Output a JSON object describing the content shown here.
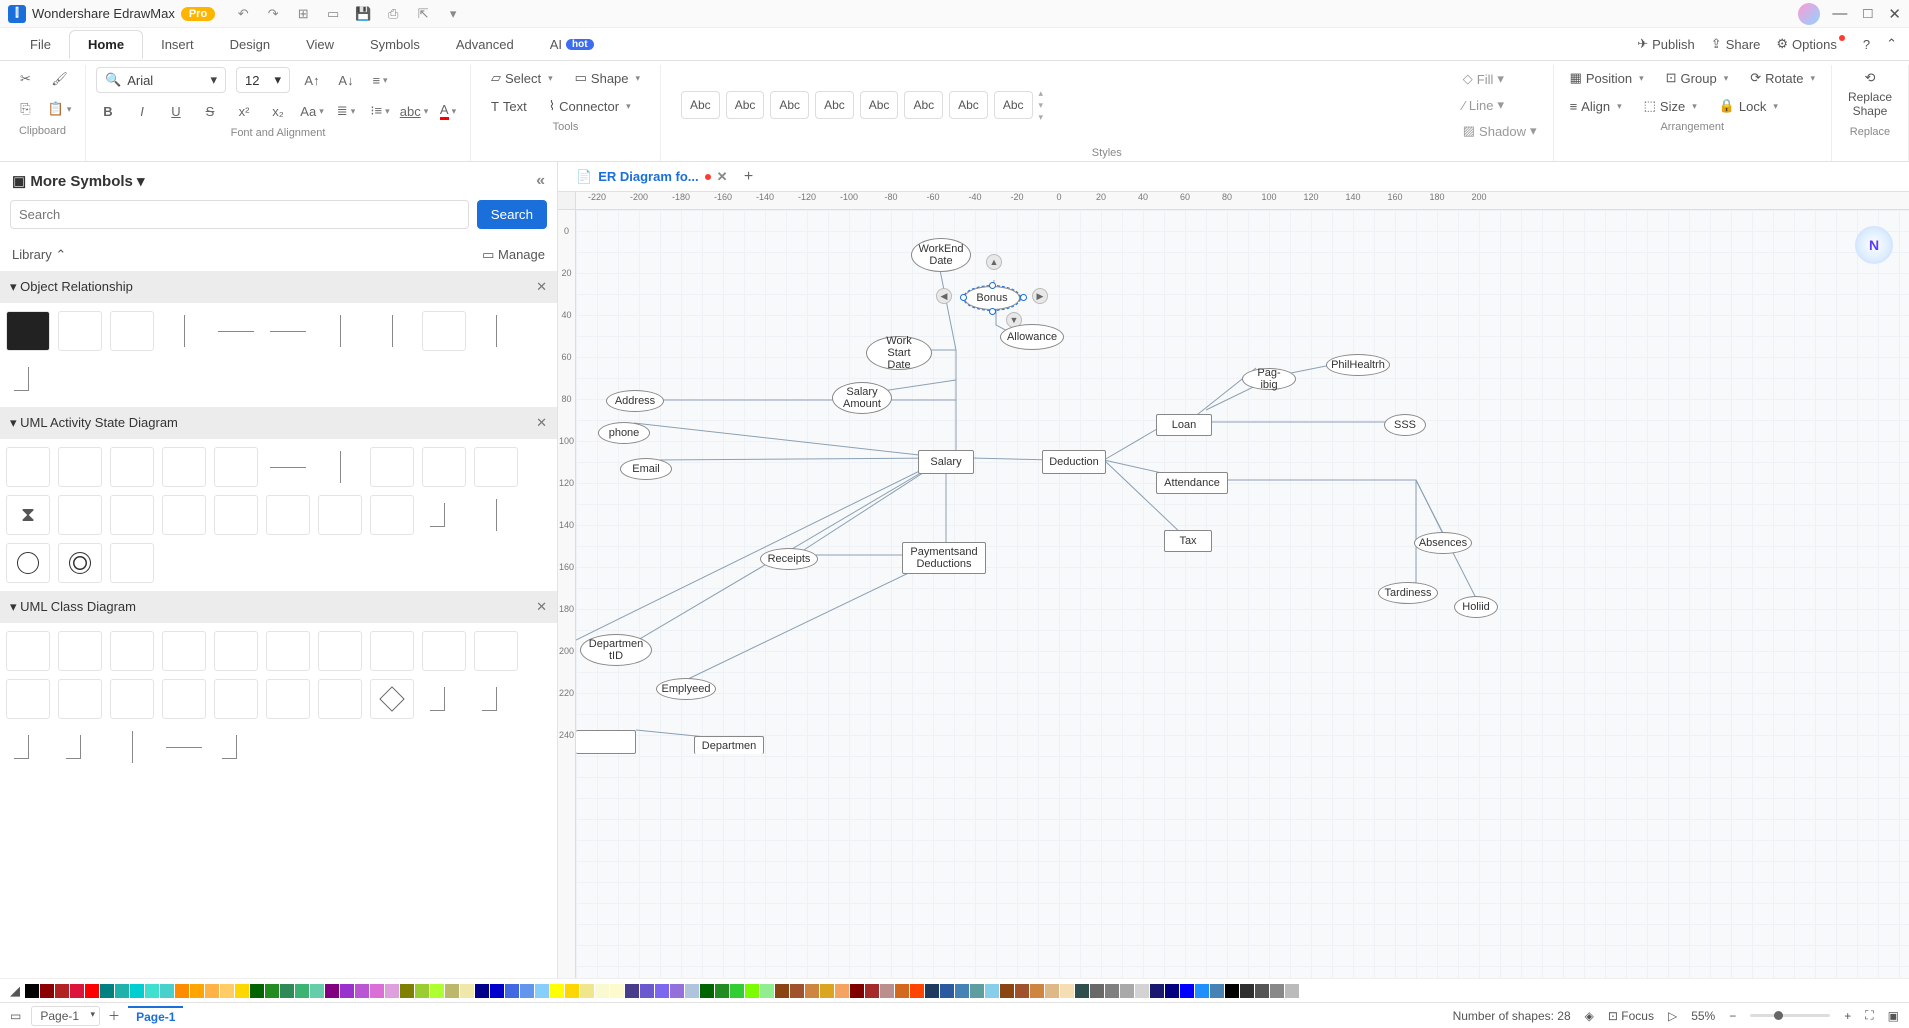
{
  "titlebar": {
    "brand": "Wondershare EdrawMax",
    "pro": "Pro"
  },
  "menu": {
    "tabs": [
      "File",
      "Home",
      "Insert",
      "Design",
      "View",
      "Symbols",
      "Advanced"
    ],
    "ai": "AI",
    "ai_badge": "hot",
    "publish": "Publish",
    "share": "Share",
    "options": "Options"
  },
  "ribbon": {
    "font_name": "Arial",
    "font_size": "12",
    "select": "Select",
    "shape": "Shape",
    "text": "Text",
    "connector": "Connector",
    "abc": "Abc",
    "fill": "Fill",
    "line": "Line",
    "shadow": "Shadow",
    "position": "Position",
    "group": "Group",
    "rotate": "Rotate",
    "align": "Align",
    "size": "Size",
    "lock": "Lock",
    "replace_shape": "Replace\nShape",
    "groups": {
      "clipboard": "Clipboard",
      "font": "Font and Alignment",
      "tools": "Tools",
      "styles": "Styles",
      "arrangement": "Arrangement",
      "replace": "Replace"
    }
  },
  "sidebar": {
    "title": "More Symbols",
    "search_placeholder": "Search",
    "search_btn": "Search",
    "library": "Library",
    "manage": "Manage",
    "cats": {
      "obj_rel": "Object Relationship",
      "uml_activity": "UML Activity State Diagram",
      "uml_class": "UML Class Diagram"
    }
  },
  "doc": {
    "tab_title": "ER Diagram fo..."
  },
  "ruler_h": [
    "-220",
    "-200",
    "-180",
    "-160",
    "-140",
    "-120",
    "-100",
    "-80",
    "-60",
    "-40",
    "-20",
    "0",
    "20",
    "40",
    "60",
    "80",
    "100",
    "120",
    "140",
    "160",
    "180",
    "200"
  ],
  "ruler_v": [
    "0",
    "20",
    "40",
    "60",
    "80",
    "100",
    "120",
    "140",
    "160",
    "180",
    "200",
    "220",
    "240"
  ],
  "shapes": {
    "workend": "WorkEnd\nDate",
    "bonus": "Bonus",
    "allowance": "Allowance",
    "workstart": "Work Start\nDate",
    "salaryamount": "Salary\nAmount",
    "address": "Address",
    "phone": "phone",
    "email": "Email",
    "salary": "Salary",
    "deduction": "Deduction",
    "pagibig": "Pag-ibig",
    "philhealth": "PhilHealtrh",
    "loan": "Loan",
    "sss": "SSS",
    "attendance": "Attendance",
    "tax": "Tax",
    "receipts": "Receipts",
    "payments": "Paymentsand\nDeductions",
    "absences": "Absences",
    "tardiness": "Tardiness",
    "holiday": "Holiid",
    "deptid": "Departmen\ntID",
    "employed": "Emplyeed",
    "departmen": "Departmen"
  },
  "status": {
    "page_dd": "Page-1",
    "page_tab": "Page-1",
    "shapes_count": "Number of shapes: 28",
    "focus": "Focus",
    "zoom": "55%"
  },
  "colors": [
    "#000000",
    "#8b0000",
    "#b22222",
    "#dc143c",
    "#ff0000",
    "#008080",
    "#20b2aa",
    "#00ced1",
    "#40e0d0",
    "#48d1cc",
    "#ff8c00",
    "#ffa500",
    "#ffb347",
    "#ffcc66",
    "#ffd700",
    "#006400",
    "#228b22",
    "#2e8b57",
    "#3cb371",
    "#66cdaa",
    "#800080",
    "#9932cc",
    "#ba55d3",
    "#da70d6",
    "#dda0dd",
    "#808000",
    "#9acd32",
    "#adff2f",
    "#bdb76b",
    "#eee8aa",
    "#00008b",
    "#0000cd",
    "#4169e1",
    "#6495ed",
    "#87cefa",
    "#ffff00",
    "#ffd700",
    "#f0e68c",
    "#fafad2",
    "#fffacd",
    "#483d8b",
    "#6a5acd",
    "#7b68ee",
    "#9370db",
    "#b0c4de",
    "#006400",
    "#228b22",
    "#32cd32",
    "#7cfc00",
    "#90ee90",
    "#8b4513",
    "#a0522d",
    "#cd853f",
    "#daa520",
    "#f4a460",
    "#800000",
    "#a52a2a",
    "#bc8f8f",
    "#d2691e",
    "#ff4500",
    "#1e3a5f",
    "#2c5aa0",
    "#4682b4",
    "#5f9ea0",
    "#87ceeb",
    "#8b4513",
    "#a0522d",
    "#cd853f",
    "#deb887",
    "#f5deb3",
    "#2f4f4f",
    "#696969",
    "#808080",
    "#a9a9a9",
    "#d3d3d3",
    "#191970",
    "#000080",
    "#0000ff",
    "#1e90ff",
    "#4682b4",
    "#000000",
    "#2f2f2f",
    "#555555",
    "#888888",
    "#bbbbbb",
    "#ffffff"
  ]
}
